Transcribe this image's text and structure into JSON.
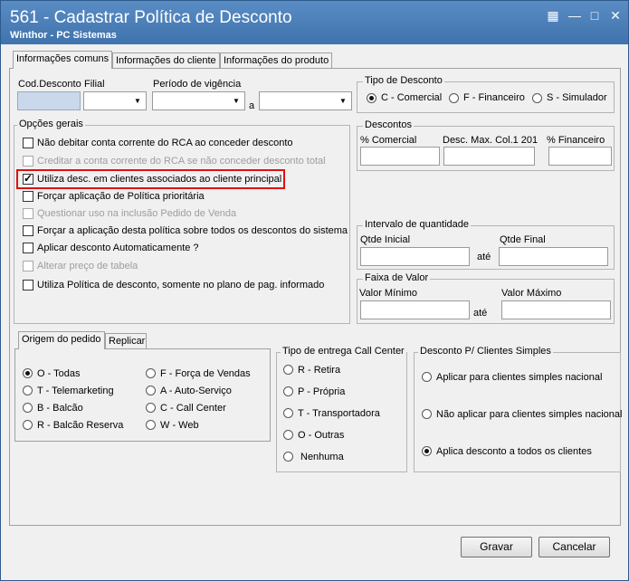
{
  "window": {
    "title": "561 - Cadastrar Política de Desconto",
    "subtitle": "Winthor - PC Sistemas",
    "controls": [
      "restore-icon",
      "minimize-icon",
      "maximize-icon",
      "close-icon"
    ]
  },
  "tabs": [
    "Informações comuns",
    "Informações do cliente",
    "Informações do produto"
  ],
  "fields": {
    "cod_desconto_label": "Cod.Desconto",
    "filial_label": "Filial",
    "periodo_label": "Período de vigência",
    "periodo_sep": "a"
  },
  "tipo_desconto": {
    "legend": "Tipo de Desconto",
    "options": [
      "C - Comercial",
      "F - Financeiro",
      "S - Simulador"
    ],
    "selected": "C - Comercial"
  },
  "opcoes_gerais": {
    "legend": "Opções gerais",
    "items": [
      {
        "label": "Não debitar conta corrente do RCA ao conceder desconto",
        "checked": false,
        "enabled": true
      },
      {
        "label": "Creditar a conta corrente do RCA se não conceder desconto total",
        "checked": false,
        "enabled": false
      },
      {
        "label": "Utiliza desc. em clientes associados ao cliente principal",
        "checked": true,
        "enabled": true
      },
      {
        "label": "Forçar aplicação de Política prioritária",
        "checked": false,
        "enabled": true
      },
      {
        "label": "Questionar uso na inclusão Pedido de Venda",
        "checked": false,
        "enabled": false
      },
      {
        "label": "Forçar a aplicação desta política sobre todos os descontos do sistema",
        "checked": false,
        "enabled": true
      },
      {
        "label": "Aplicar desconto Automaticamente ?",
        "checked": false,
        "enabled": true
      },
      {
        "label": "Alterar preço de tabela",
        "checked": false,
        "enabled": false
      },
      {
        "label": "Utiliza Política de desconto, somente no plano de pag. informado",
        "checked": false,
        "enabled": true
      }
    ]
  },
  "descontos": {
    "legend": "Descontos",
    "cols": [
      "% Comercial",
      "Desc. Max. Col.1 201",
      "% Financeiro"
    ]
  },
  "intervalo": {
    "legend": "Intervalo de quantidade",
    "from_label": "Qtde Inicial",
    "to_label": "Qtde Final",
    "sep": "até"
  },
  "faixa": {
    "legend": "Faixa de Valor",
    "from_label": "Valor Mínimo",
    "to_label": "Valor Máximo",
    "sep": "até"
  },
  "lower_tabs": [
    "Origem do pedido",
    "Replicar"
  ],
  "origem": {
    "col1": [
      "O - Todas",
      "T - Telemarketing",
      "B - Balcão",
      "R - Balcão Reserva"
    ],
    "col2": [
      "F - Força de Vendas",
      "A - Auto-Serviço",
      "C - Call Center",
      "W - Web"
    ],
    "selected": "O - Todas"
  },
  "entrega": {
    "legend": "Tipo de entrega Call Center",
    "options": [
      "R - Retira",
      "P - Própria",
      "T - Transportadora",
      "O - Outras",
      "Nenhuma"
    ]
  },
  "simples": {
    "legend": "Desconto P/ Clientes Simples",
    "options": [
      "Aplicar para clientes simples nacional",
      "Não aplicar para clientes simples nacional",
      "Aplica desconto a todos os clientes"
    ],
    "selected": "Aplica desconto a todos os clientes"
  },
  "buttons": {
    "save": "Gravar",
    "cancel": "Cancelar"
  }
}
